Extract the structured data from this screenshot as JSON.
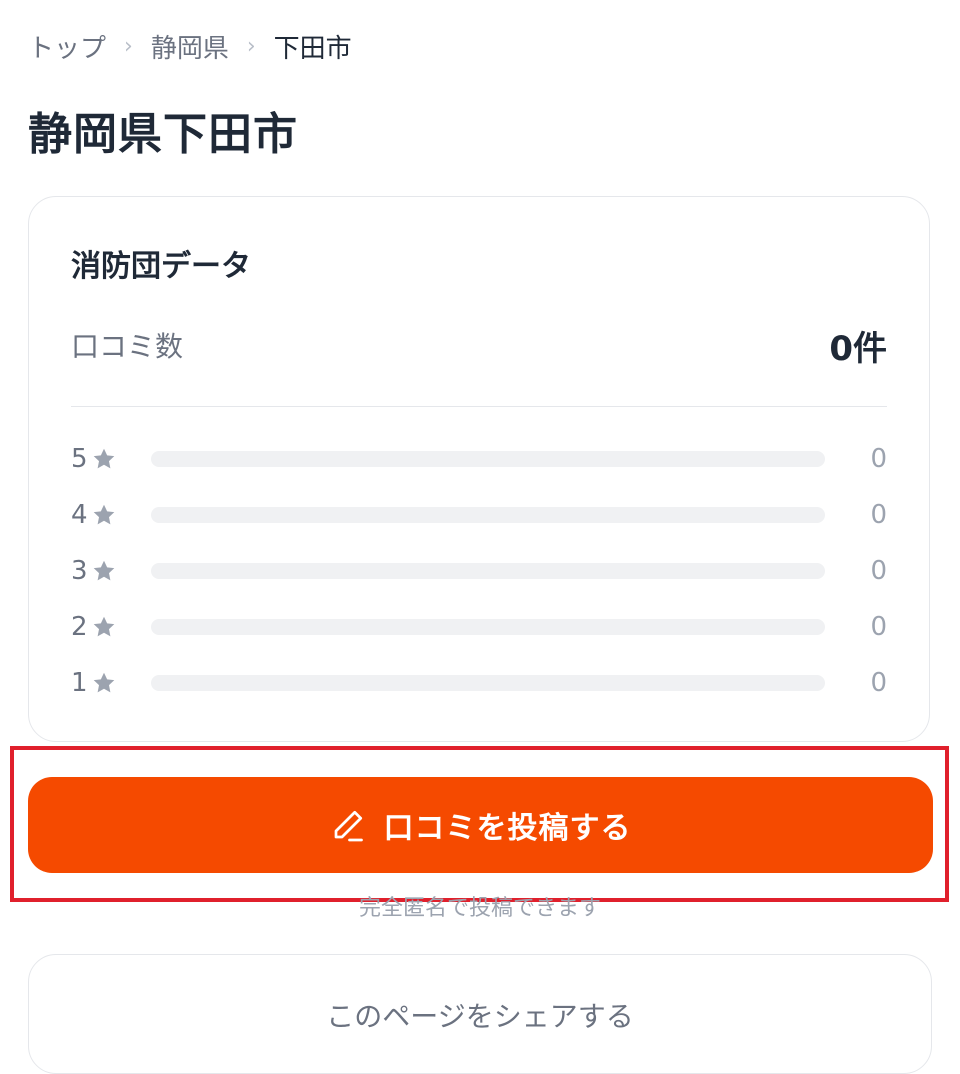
{
  "breadcrumb": {
    "items": [
      "トップ",
      "静岡県",
      "下田市"
    ],
    "separator": "›"
  },
  "page_title": "静岡県下田市",
  "stats_card": {
    "title": "消防団データ",
    "review_count_label": "口コミ数",
    "review_count_value": "0件",
    "ratings": [
      {
        "stars": "5",
        "count": "0",
        "fill": 0
      },
      {
        "stars": "4",
        "count": "0",
        "fill": 0
      },
      {
        "stars": "3",
        "count": "0",
        "fill": 0
      },
      {
        "stars": "2",
        "count": "0",
        "fill": 0
      },
      {
        "stars": "1",
        "count": "0",
        "fill": 0
      }
    ]
  },
  "post_button": {
    "label": "口コミを投稿する",
    "icon": "pencil-icon"
  },
  "anonymous_note": "完全匿名で投稿できます",
  "share": {
    "label": "このページをシェアする"
  },
  "colors": {
    "accent": "#f54a00",
    "highlight_outline": "#e0202c",
    "star": "#9ca3af"
  }
}
